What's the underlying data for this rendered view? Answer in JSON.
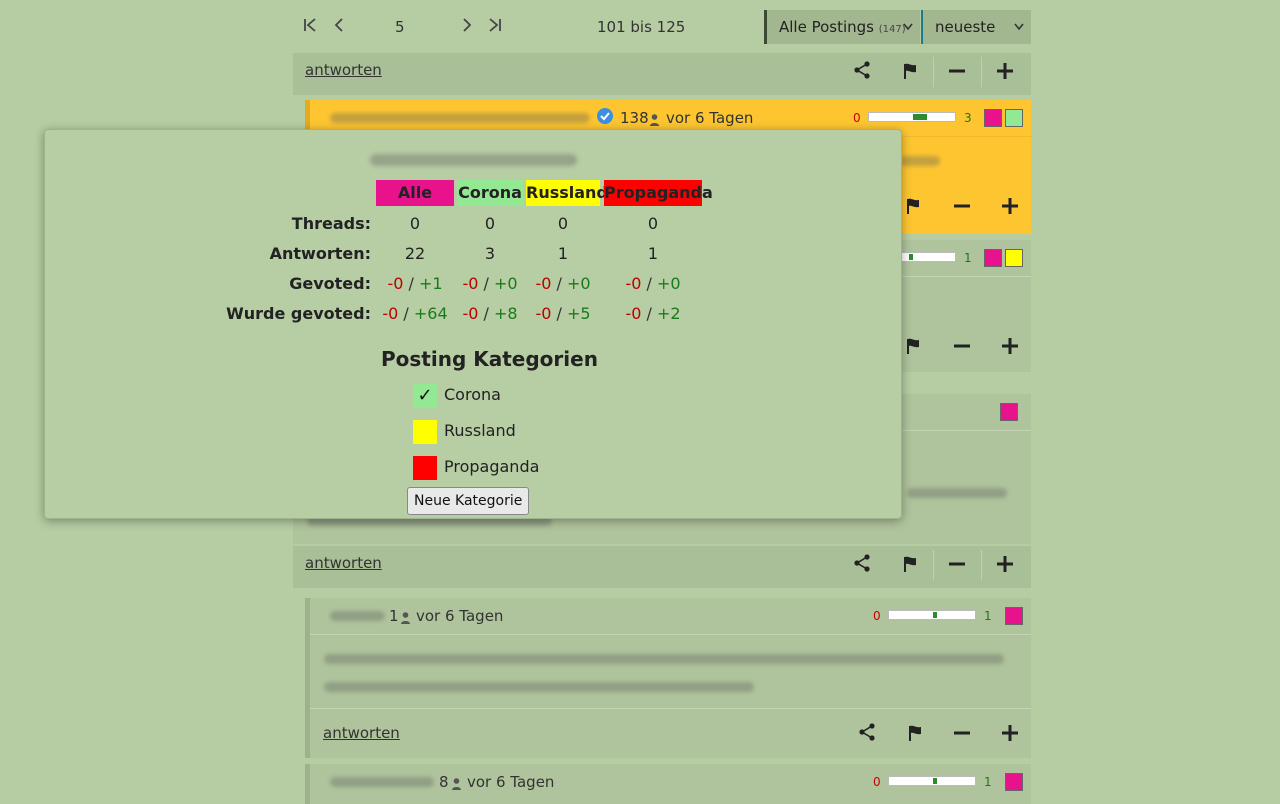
{
  "pager": {
    "page": "5",
    "range": "101 bis 125",
    "filter_label": "Alle Postings",
    "filter_count": "(147)",
    "sort_label": "neueste"
  },
  "actions": {
    "reply_label": "antworten"
  },
  "posts": [
    {
      "count": "138",
      "time": "vor 6 Tagen",
      "neg": "0",
      "pos": "3"
    },
    {
      "pos": "1"
    },
    {
      "count": "1",
      "time": "vor 6 Tagen",
      "neg": "0",
      "pos": "1"
    },
    {
      "count": "8",
      "time": "vor 6 Tagen",
      "neg": "0",
      "pos": "1"
    }
  ],
  "popup": {
    "columns": [
      "Alle",
      "Corona",
      "Russland",
      "Propaganda"
    ],
    "rows": {
      "threads_label": "Threads:",
      "antworten_label": "Antworten:",
      "gevotet_label": "Gevoted:",
      "wurde_label": "Wurde gevoted:"
    },
    "threads": [
      "0",
      "0",
      "0",
      "0"
    ],
    "antworten": [
      "22",
      "3",
      "1",
      "1"
    ],
    "gevoted_neg": [
      "-0",
      "-0",
      "-0",
      "-0"
    ],
    "gevoted_pos": [
      "+1",
      "+0",
      "+0",
      "+0"
    ],
    "wurde_neg": [
      "-0",
      "-0",
      "-0",
      "-0"
    ],
    "wurde_pos": [
      "+64",
      "+8",
      "+5",
      "+2"
    ],
    "categories_title": "Posting Kategorien",
    "categories": [
      {
        "label": "Corona",
        "checked": true
      },
      {
        "label": "Russland",
        "checked": false
      },
      {
        "label": "Propaganda",
        "checked": false
      }
    ],
    "check_mark": "✓",
    "new_category_label": "Neue Kategorie"
  },
  "colors": {
    "alle": "#e8128c",
    "corona": "#93e893",
    "russland": "#ffff00",
    "propaganda": "#ff0000",
    "highlight": "#fdc631"
  },
  "separator": "/"
}
